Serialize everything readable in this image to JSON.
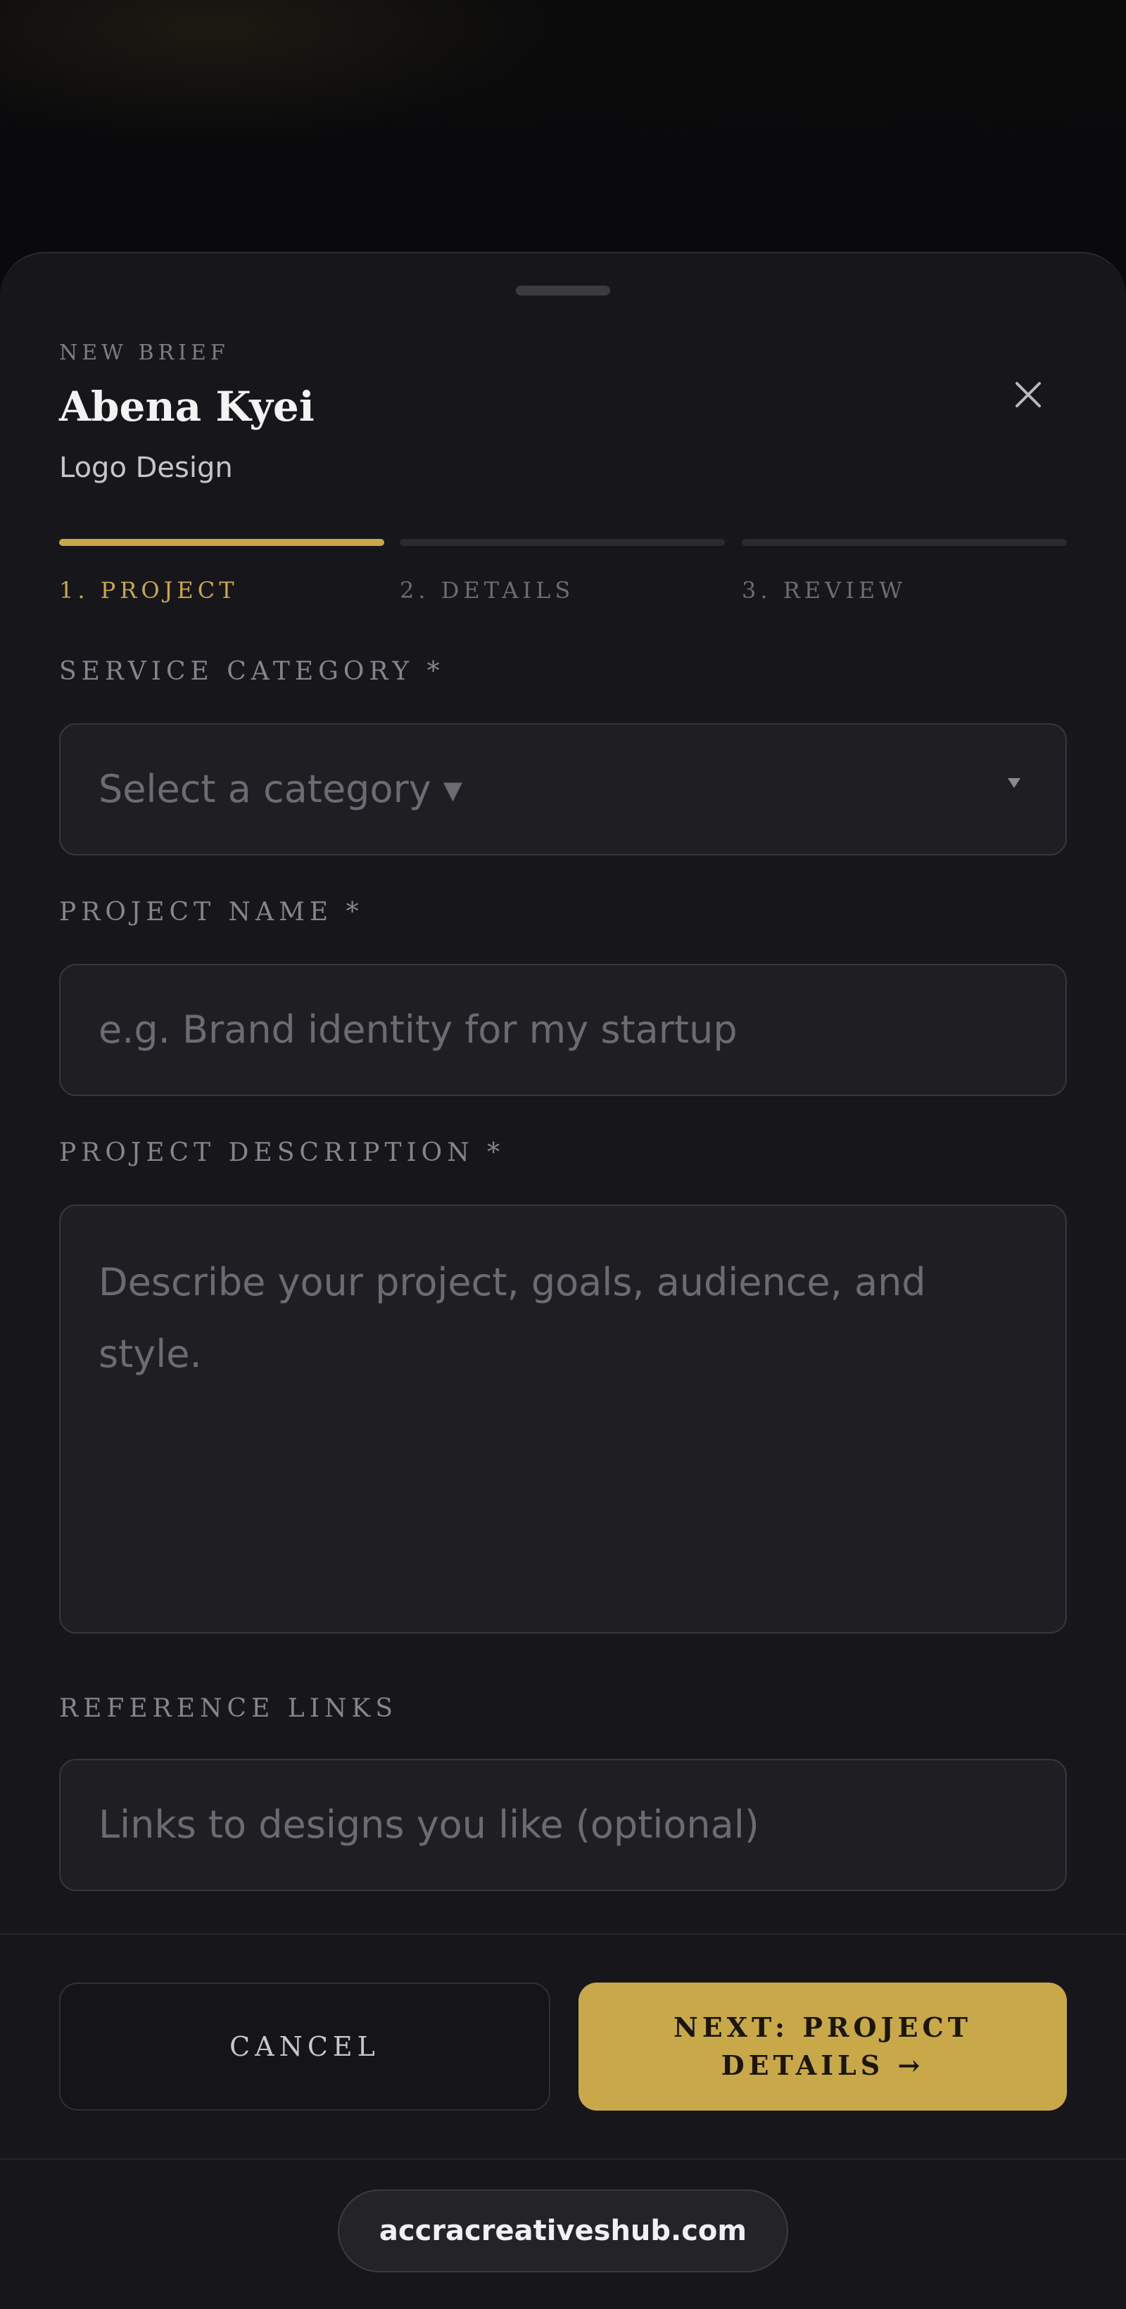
{
  "modal": {
    "eyebrow": "NEW BRIEF",
    "title": "Abena Kyei",
    "subtitle": "Logo Design",
    "close_icon": "close-icon"
  },
  "steps": [
    {
      "label": "1. PROJECT",
      "active": true
    },
    {
      "label": "2. DETAILS",
      "active": false
    },
    {
      "label": "3. REVIEW",
      "active": false
    }
  ],
  "fields": {
    "category": {
      "label": "SERVICE CATEGORY *",
      "placeholder": "Select a category ▾"
    },
    "name": {
      "label": "PROJECT NAME *",
      "placeholder": "e.g. Brand identity for my startup"
    },
    "description": {
      "label": "PROJECT DESCRIPTION *",
      "placeholder": "Describe your project, goals, audience, and style."
    },
    "links": {
      "label": "REFERENCE LINKS",
      "placeholder": "Links to designs you like (optional)"
    }
  },
  "buttons": {
    "cancel": "CANCEL",
    "next": "NEXT: PROJECT DETAILS →"
  },
  "browser": {
    "url": "accracreativeshub.com"
  },
  "colors": {
    "accent": "#c9a84a",
    "sheet_bg": "#17171b",
    "field_bg": "#1e1e23",
    "inactive_step": "#2a2a2f"
  }
}
